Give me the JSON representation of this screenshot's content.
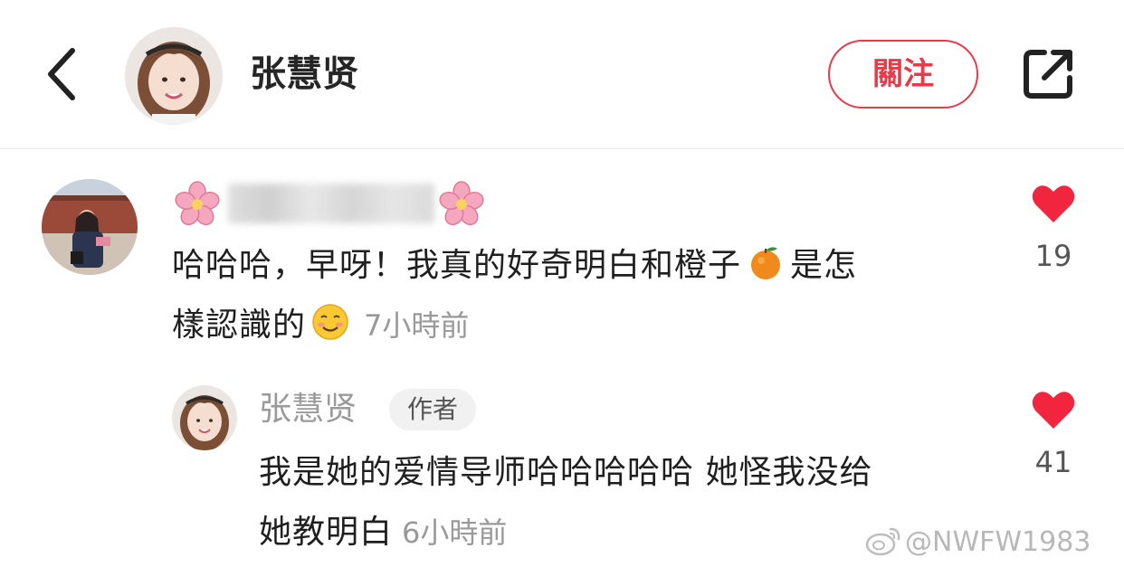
{
  "header": {
    "back_icon": "chevron-left-icon",
    "profile_name": "张慧贤",
    "follow_label": "關注",
    "share_icon": "share-external-icon",
    "accent_color": "#e83a4b"
  },
  "comment": {
    "name_decoration_icon": "cherry-blossom-icon",
    "text_line1": "哈哈哈，早呀！我真的好奇明白和橙子",
    "text_line1_emoji": "tangerine-icon",
    "text_line1_tail": "是怎",
    "text_line2": "樣認識的",
    "text_line2_emoji": "smiling-face-icon",
    "time": "7小時前",
    "like_icon": "heart-icon",
    "likes": "19"
  },
  "reply": {
    "author_name": "张慧贤",
    "author_badge": "作者",
    "text_line1": "我是她的爱情导师哈哈哈哈哈 她怪我没给",
    "text_line2": "她教明白",
    "time": "6小時前",
    "like_icon": "heart-icon",
    "likes": "41"
  },
  "watermark": {
    "icon": "weibo-icon",
    "text": "@NWFW1983"
  }
}
